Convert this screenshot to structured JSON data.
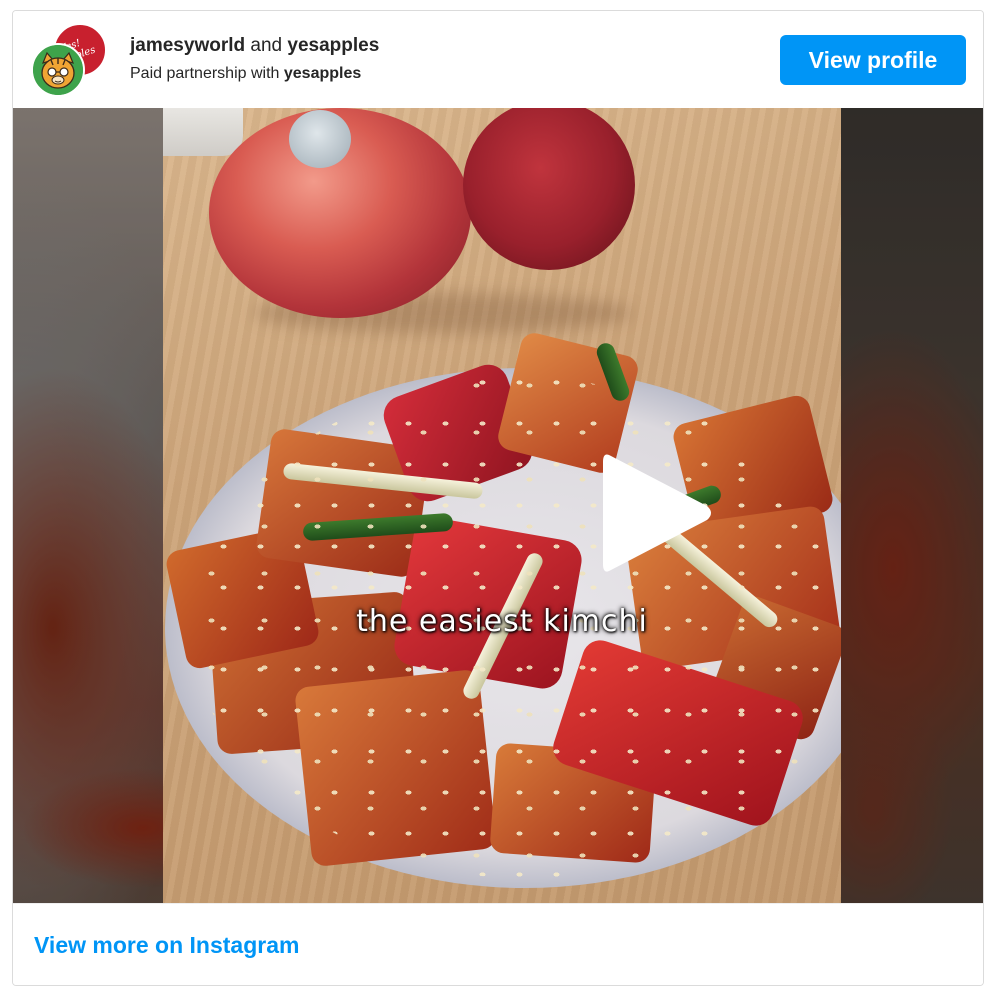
{
  "header": {
    "author": "jamesyworld",
    "joiner": "and",
    "collaborator": "yesapples",
    "partnership_prefix": "Paid partnership with",
    "partner": "yesapples",
    "view_profile_label": "View profile"
  },
  "avatars": {
    "back_logo_text": "Yes! apples",
    "back_color": "#c8202e",
    "front_color": "#3ea34b",
    "front_icon": "cartoon-tiger-face-icon"
  },
  "media": {
    "caption": "the easiest kimchi",
    "play_icon": "play-icon"
  },
  "footer": {
    "link_label": "View more on Instagram"
  },
  "colors": {
    "accent": "#0095f6",
    "text": "#262626",
    "border": "#dbdbdb"
  }
}
